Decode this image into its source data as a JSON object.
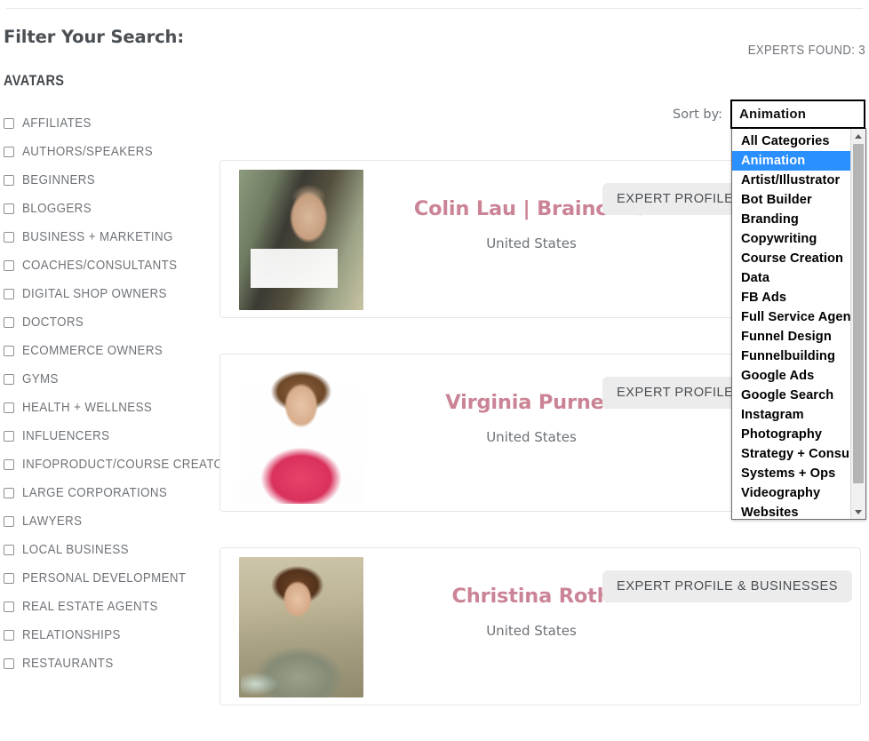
{
  "sidebar": {
    "filter_title": "Filter Your Search:",
    "group_heading": "AVATARS",
    "items": [
      {
        "label": "AFFILIATES",
        "checked": false
      },
      {
        "label": "AUTHORS/SPEAKERS",
        "checked": false
      },
      {
        "label": "BEGINNERS",
        "checked": false
      },
      {
        "label": "BLOGGERS",
        "checked": false
      },
      {
        "label": "BUSINESS + MARKETING",
        "checked": false
      },
      {
        "label": "COACHES/CONSULTANTS",
        "checked": false
      },
      {
        "label": "DIGITAL SHOP OWNERS",
        "checked": false
      },
      {
        "label": "DOCTORS",
        "checked": false
      },
      {
        "label": "ECOMMERCE OWNERS",
        "checked": false
      },
      {
        "label": "GYMS",
        "checked": false
      },
      {
        "label": "HEALTH + WELLNESS",
        "checked": false
      },
      {
        "label": "INFLUENCERS",
        "checked": false
      },
      {
        "label": "INFOPRODUCT/COURSE CREATORS",
        "checked": false
      },
      {
        "label": "LARGE CORPORATIONS",
        "checked": false
      },
      {
        "label": "LAWYERS",
        "checked": false
      },
      {
        "label": "LOCAL BUSINESS",
        "checked": false
      },
      {
        "label": "PERSONAL DEVELOPMENT",
        "checked": false
      },
      {
        "label": "REAL ESTATE AGENTS",
        "checked": false
      },
      {
        "label": "RELATIONSHIPS",
        "checked": false
      },
      {
        "label": "RESTAURANTS",
        "checked": false
      }
    ]
  },
  "results": {
    "experts_found": "EXPERTS FOUND: 3"
  },
  "sort": {
    "label": "Sort by:",
    "selected": "Animation",
    "options": [
      "All Categories",
      "Animation",
      "Artist/Illustrator",
      "Bot Builder",
      "Branding",
      "Copywriting",
      "Course Creation",
      "Data",
      "FB Ads",
      "Full Service Agency",
      "Funnel Design",
      "Funnelbuilding",
      "Google Ads",
      "Google Search",
      "Instagram",
      "Photography",
      "Strategy + Consulting",
      "Systems + Ops",
      "Videography",
      "Websites"
    ],
    "highlight_color": "#2a8fff"
  },
  "experts": [
    {
      "name": "Colin Lau | Brainchild",
      "country": "United States",
      "button_label": "EXPERT PROFILE & BUSINESSES",
      "photo_class": "ph1"
    },
    {
      "name": "Virginia Purnell",
      "country": "United States",
      "button_label": "EXPERT PROFILE & BUSINESSES",
      "photo_class": "ph2"
    },
    {
      "name": "Christina Roth",
      "country": "United States",
      "button_label": "EXPERT PROFILE & BUSINESSES",
      "photo_class": "ph3"
    }
  ],
  "theme": {
    "name_color": "#cb8496",
    "text_color": "#6f7378",
    "button_bg": "#ececec"
  }
}
